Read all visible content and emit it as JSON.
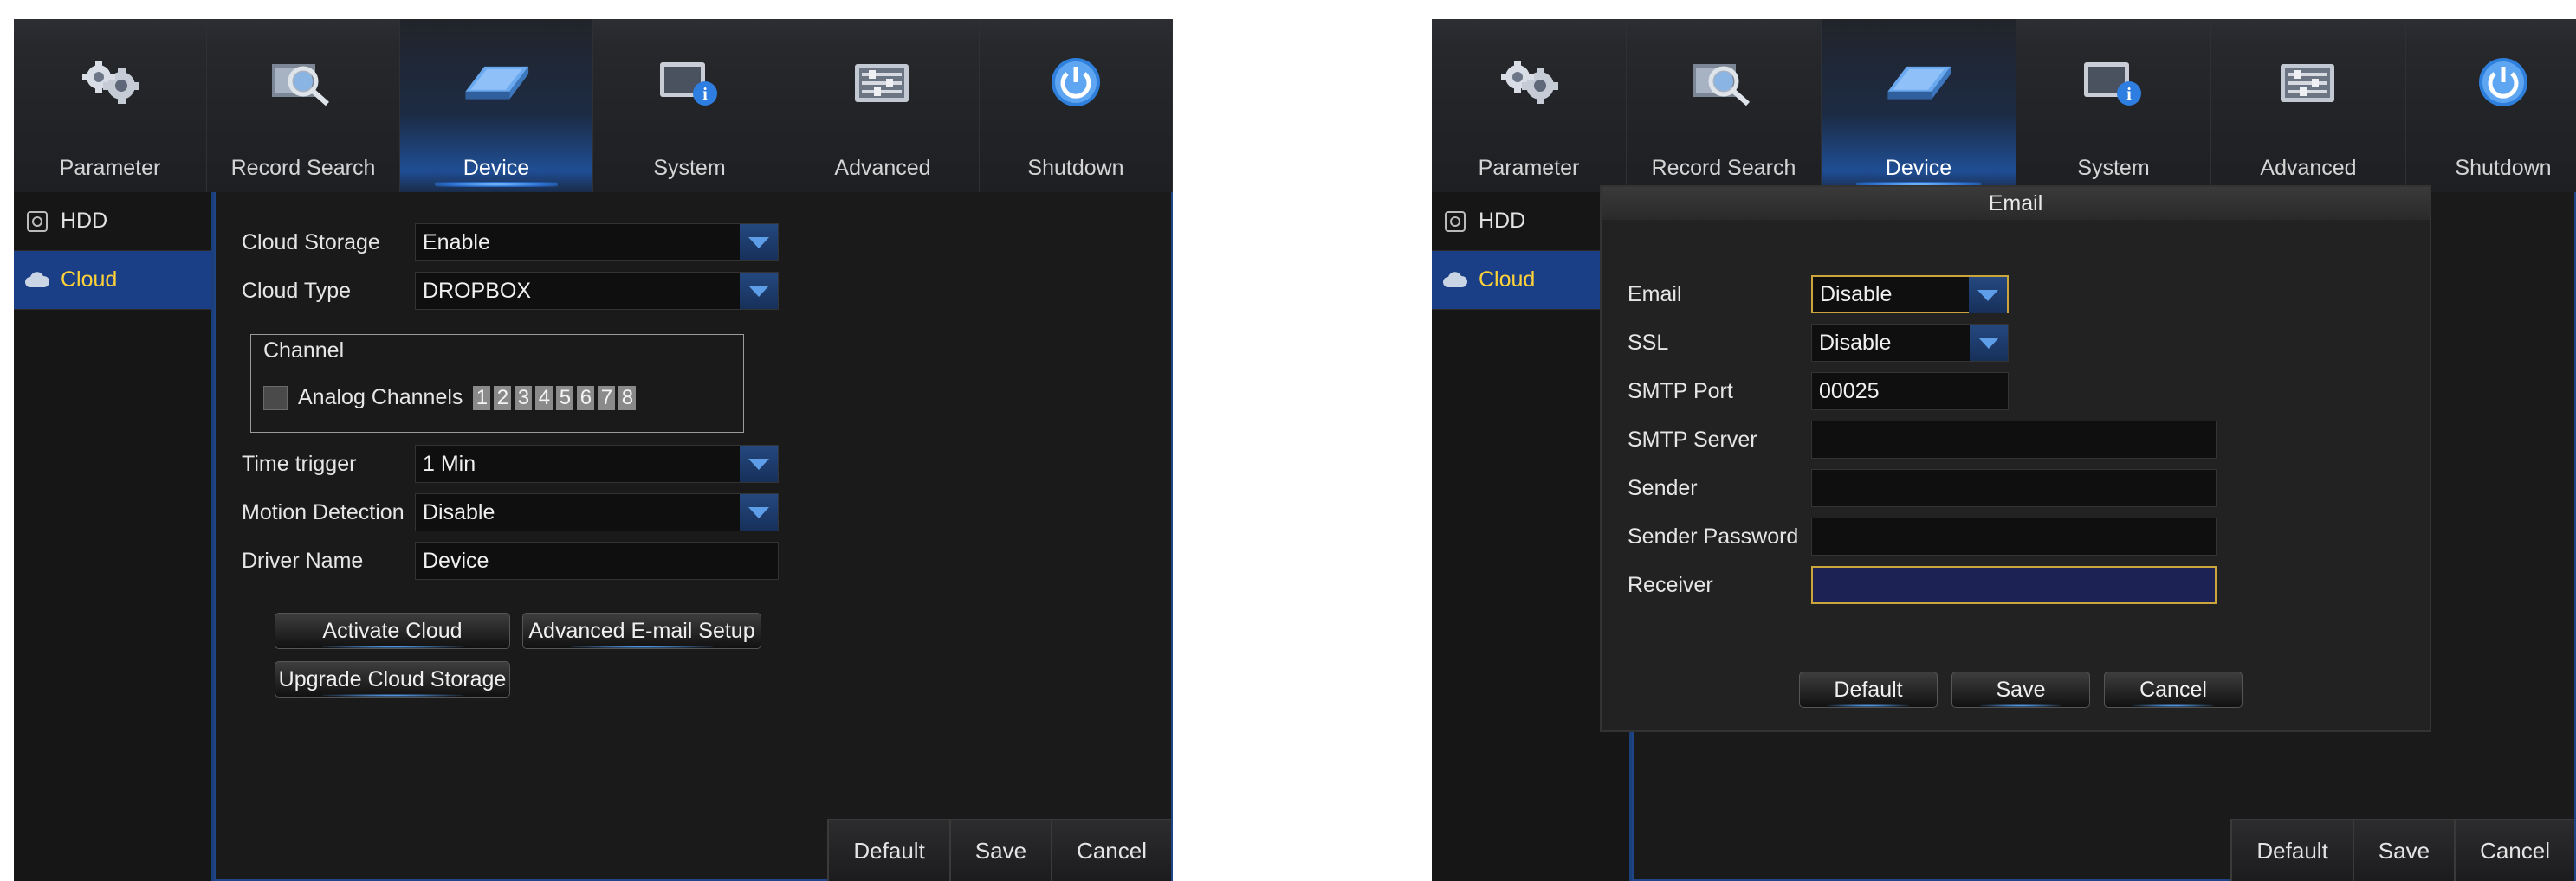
{
  "left_screen": {
    "nav": [
      {
        "label": "Parameter",
        "icon": "gears-icon",
        "active": false
      },
      {
        "label": "Record Search",
        "icon": "record-search-icon",
        "active": false
      },
      {
        "label": "Device",
        "icon": "device-hdd-icon",
        "active": true
      },
      {
        "label": "System",
        "icon": "system-info-icon",
        "active": false
      },
      {
        "label": "Advanced",
        "icon": "advanced-settings-icon",
        "active": false
      },
      {
        "label": "Shutdown",
        "icon": "power-icon",
        "active": false
      }
    ],
    "sidebar": [
      {
        "label": "HDD",
        "icon": "hdd-icon",
        "active": false
      },
      {
        "label": "Cloud",
        "icon": "cloud-icon",
        "active": true
      }
    ],
    "form": {
      "cloud_storage": {
        "label": "Cloud Storage",
        "value": "Enable"
      },
      "cloud_type": {
        "label": "Cloud Type",
        "value": "DROPBOX"
      },
      "channel": {
        "title": "Channel",
        "analog_label": "Analog Channels",
        "numbers": [
          "1",
          "2",
          "3",
          "4",
          "5",
          "6",
          "7",
          "8"
        ]
      },
      "time_trigger": {
        "label": "Time trigger",
        "value": "1 Min"
      },
      "motion_detection": {
        "label": "Motion Detection",
        "value": "Disable"
      },
      "driver_name": {
        "label": "Driver Name",
        "value": "Device"
      }
    },
    "buttons": {
      "activate": "Activate Cloud",
      "advanced_email": "Advanced E-mail Setup",
      "upgrade": "Upgrade Cloud Storage"
    },
    "bottom": {
      "default": "Default",
      "save": "Save",
      "cancel": "Cancel"
    }
  },
  "right_screen": {
    "nav": [
      {
        "label": "Parameter",
        "icon": "gears-icon",
        "active": false
      },
      {
        "label": "Record Search",
        "icon": "record-search-icon",
        "active": false
      },
      {
        "label": "Device",
        "icon": "device-hdd-icon",
        "active": true
      },
      {
        "label": "System",
        "icon": "system-info-icon",
        "active": false
      },
      {
        "label": "Advanced",
        "icon": "advanced-settings-icon",
        "active": false
      },
      {
        "label": "Shutdown",
        "icon": "power-icon",
        "active": false
      }
    ],
    "sidebar": [
      {
        "label": "HDD",
        "icon": "hdd-icon",
        "active": false
      },
      {
        "label": "Cloud",
        "icon": "cloud-icon",
        "active": true
      }
    ],
    "dialog": {
      "title": "Email",
      "email": {
        "label": "Email",
        "value": "Disable"
      },
      "ssl": {
        "label": "SSL",
        "value": "Disable"
      },
      "smtp_port": {
        "label": "SMTP Port",
        "value": "00025"
      },
      "smtp_server": {
        "label": "SMTP Server",
        "value": ""
      },
      "sender": {
        "label": "Sender",
        "value": ""
      },
      "sender_password": {
        "label": "Sender Password",
        "value": ""
      },
      "receiver": {
        "label": "Receiver",
        "value": ""
      },
      "default": "Default",
      "save": "Save",
      "cancel": "Cancel"
    },
    "bottom": {
      "default": "Default",
      "save": "Save",
      "cancel": "Cancel"
    }
  }
}
